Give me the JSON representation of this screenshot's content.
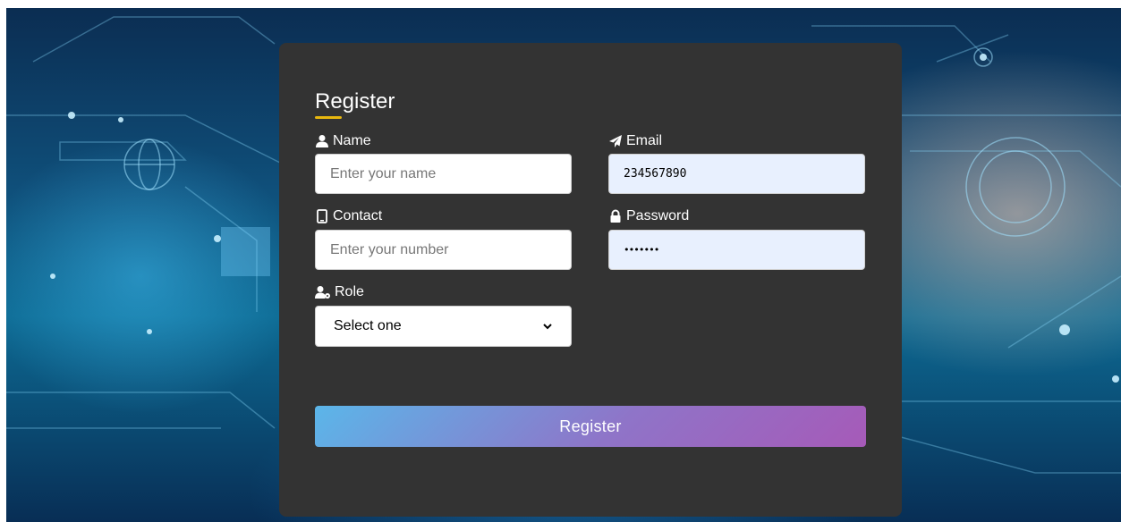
{
  "form": {
    "title": "Register",
    "name": {
      "label": "Name",
      "placeholder": "Enter your name",
      "value": ""
    },
    "email": {
      "label": "Email",
      "value": "234567890"
    },
    "contact": {
      "label": "Contact",
      "placeholder": "Enter your number",
      "value": ""
    },
    "password": {
      "label": "Password",
      "masked_value": "•••••••"
    },
    "role": {
      "label": "Role",
      "selected": "Select one"
    },
    "submit_label": "Register"
  },
  "icons": {
    "name": "user-icon",
    "email": "paper-plane-icon",
    "contact": "mobile-phone-icon",
    "password": "lock-icon",
    "role": "user-gear-icon",
    "select": "chevron-down-icon"
  },
  "colors": {
    "card_bg": "#333333",
    "title_underline": "#e8b70e",
    "autofill_bg": "#e8f0fe",
    "button_gradient_start": "#5bb6e9",
    "button_gradient_end": "#a65ab8"
  }
}
